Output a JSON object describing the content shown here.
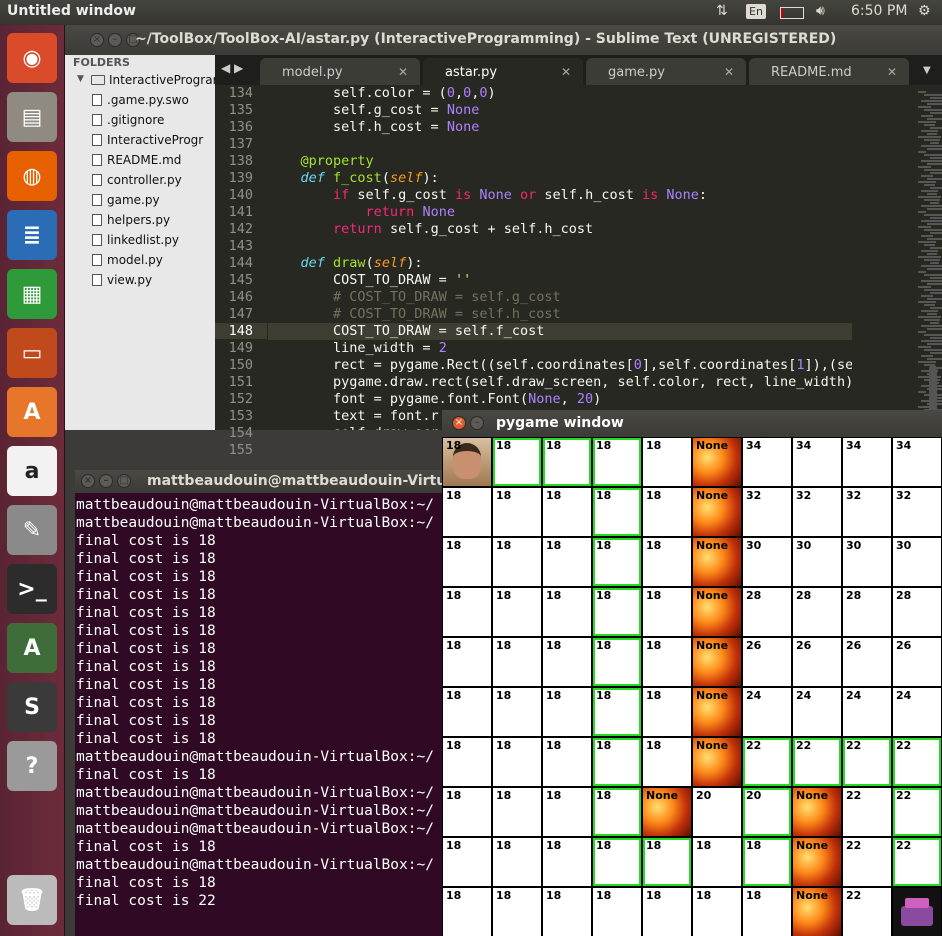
{
  "topbar": {
    "title": "Untitled window",
    "keyboard": "En",
    "time": "6:50 PM"
  },
  "launcher": {
    "items": [
      {
        "name": "dash-button",
        "icon": "ubuntu-logo-icon",
        "color": "#d94b29"
      },
      {
        "name": "files-button",
        "icon": "file-cabinet-icon",
        "color": "#8f8b80"
      },
      {
        "name": "firefox-button",
        "icon": "firefox-icon",
        "color": "#e66000"
      },
      {
        "name": "writer-button",
        "icon": "writer-document-icon",
        "color": "#2a6db5"
      },
      {
        "name": "calc-button",
        "icon": "calc-spreadsheet-icon",
        "color": "#2e9a3a"
      },
      {
        "name": "impress-button",
        "icon": "impress-presentation-icon",
        "color": "#c04a1c"
      },
      {
        "name": "software-center-button",
        "icon": "shopping-bag-icon",
        "color": "#e7762a"
      },
      {
        "name": "amazon-button",
        "icon": "amazon-icon",
        "color": "#f2f2f2"
      },
      {
        "name": "settings-button",
        "icon": "wrench-gear-icon",
        "color": "#8a8a8a"
      },
      {
        "name": "terminal-button",
        "icon": "terminal-icon",
        "color": "#2c2c2c"
      },
      {
        "name": "updater-button",
        "icon": "update-icon",
        "color": "#3f6d3a"
      },
      {
        "name": "sublime-button",
        "icon": "sublime-icon",
        "color": "#3a3a3a"
      },
      {
        "name": "help-button",
        "icon": "question-mark-icon",
        "color": "#9a9a9a"
      },
      {
        "name": "trash-button",
        "icon": "trash-icon",
        "color": "#bbbbbb"
      }
    ]
  },
  "sublime": {
    "title": "~/ToolBox/ToolBox-AI/astar.py (InteractiveProgramming) - Sublime Text (UNREGISTERED)",
    "sidebar": {
      "header": "FOLDERS",
      "folder": "InteractiveProgram",
      "files": [
        ".game.py.swo",
        ".gitignore",
        "InteractiveProgr",
        "README.md",
        "controller.py",
        "game.py",
        "helpers.py",
        "linkedlist.py",
        "model.py",
        "view.py"
      ]
    },
    "tabs": [
      {
        "label": "model.py"
      },
      {
        "label": "astar.py"
      },
      {
        "label": "game.py"
      },
      {
        "label": "README.md"
      }
    ],
    "line_numbers": [
      "134",
      "135",
      "136",
      "137",
      "138",
      "139",
      "140",
      "141",
      "142",
      "143",
      "144",
      "145",
      "146",
      "147",
      "148",
      "149",
      "150",
      "151",
      "152",
      "153",
      "154",
      "155"
    ]
  },
  "terminal": {
    "title": "mattbeaudouin@mattbeaudouin-VirtualB",
    "lines": [
      "mattbeaudouin@mattbeaudouin-VirtualBox:~/",
      "mattbeaudouin@mattbeaudouin-VirtualBox:~/",
      "final cost is 18",
      "final cost is 18",
      "final cost is 18",
      "final cost is 18",
      "final cost is 18",
      "final cost is 18",
      "final cost is 18",
      "final cost is 18",
      "final cost is 18",
      "final cost is 18",
      "final cost is 18",
      "final cost is 18",
      "mattbeaudouin@mattbeaudouin-VirtualBox:~/",
      "final cost is 18",
      "mattbeaudouin@mattbeaudouin-VirtualBox:~/",
      "mattbeaudouin@mattbeaudouin-VirtualBox:~/",
      "mattbeaudouin@mattbeaudouin-VirtualBox:~/",
      "final cost is 18",
      "mattbeaudouin@mattbeaudouin-VirtualBox:~/",
      "final cost is 18",
      "final cost is 22"
    ]
  },
  "pygame": {
    "title": "pygame window",
    "rows": [
      [
        {
          "v": "18",
          "s": "start"
        },
        {
          "v": "18",
          "s": "green"
        },
        {
          "v": "18",
          "s": "green"
        },
        {
          "v": "18",
          "s": "green"
        },
        {
          "v": "18",
          "s": ""
        },
        {
          "v": "None",
          "s": "fire"
        },
        {
          "v": "34",
          "s": ""
        },
        {
          "v": "34",
          "s": ""
        },
        {
          "v": "34",
          "s": ""
        },
        {
          "v": "34",
          "s": ""
        }
      ],
      [
        {
          "v": "18",
          "s": ""
        },
        {
          "v": "18",
          "s": ""
        },
        {
          "v": "18",
          "s": ""
        },
        {
          "v": "18",
          "s": "green"
        },
        {
          "v": "18",
          "s": ""
        },
        {
          "v": "None",
          "s": "fire"
        },
        {
          "v": "32",
          "s": ""
        },
        {
          "v": "32",
          "s": ""
        },
        {
          "v": "32",
          "s": ""
        },
        {
          "v": "32",
          "s": ""
        }
      ],
      [
        {
          "v": "18",
          "s": ""
        },
        {
          "v": "18",
          "s": ""
        },
        {
          "v": "18",
          "s": ""
        },
        {
          "v": "18",
          "s": "green"
        },
        {
          "v": "18",
          "s": ""
        },
        {
          "v": "None",
          "s": "fire"
        },
        {
          "v": "30",
          "s": ""
        },
        {
          "v": "30",
          "s": ""
        },
        {
          "v": "30",
          "s": ""
        },
        {
          "v": "30",
          "s": ""
        }
      ],
      [
        {
          "v": "18",
          "s": ""
        },
        {
          "v": "18",
          "s": ""
        },
        {
          "v": "18",
          "s": ""
        },
        {
          "v": "18",
          "s": "green"
        },
        {
          "v": "18",
          "s": ""
        },
        {
          "v": "None",
          "s": "fire"
        },
        {
          "v": "28",
          "s": ""
        },
        {
          "v": "28",
          "s": ""
        },
        {
          "v": "28",
          "s": ""
        },
        {
          "v": "28",
          "s": ""
        }
      ],
      [
        {
          "v": "18",
          "s": ""
        },
        {
          "v": "18",
          "s": ""
        },
        {
          "v": "18",
          "s": ""
        },
        {
          "v": "18",
          "s": "green"
        },
        {
          "v": "18",
          "s": ""
        },
        {
          "v": "None",
          "s": "fire"
        },
        {
          "v": "26",
          "s": ""
        },
        {
          "v": "26",
          "s": ""
        },
        {
          "v": "26",
          "s": ""
        },
        {
          "v": "26",
          "s": ""
        }
      ],
      [
        {
          "v": "18",
          "s": ""
        },
        {
          "v": "18",
          "s": ""
        },
        {
          "v": "18",
          "s": ""
        },
        {
          "v": "18",
          "s": "green"
        },
        {
          "v": "18",
          "s": ""
        },
        {
          "v": "None",
          "s": "fire"
        },
        {
          "v": "24",
          "s": ""
        },
        {
          "v": "24",
          "s": ""
        },
        {
          "v": "24",
          "s": ""
        },
        {
          "v": "24",
          "s": ""
        }
      ],
      [
        {
          "v": "18",
          "s": ""
        },
        {
          "v": "18",
          "s": ""
        },
        {
          "v": "18",
          "s": ""
        },
        {
          "v": "18",
          "s": "green"
        },
        {
          "v": "18",
          "s": ""
        },
        {
          "v": "None",
          "s": "fire"
        },
        {
          "v": "22",
          "s": "green"
        },
        {
          "v": "22",
          "s": "green"
        },
        {
          "v": "22",
          "s": "green"
        },
        {
          "v": "22",
          "s": "green"
        }
      ],
      [
        {
          "v": "18",
          "s": ""
        },
        {
          "v": "18",
          "s": ""
        },
        {
          "v": "18",
          "s": ""
        },
        {
          "v": "18",
          "s": "green"
        },
        {
          "v": "None",
          "s": "fire"
        },
        {
          "v": "20",
          "s": ""
        },
        {
          "v": "20",
          "s": "green"
        },
        {
          "v": "None",
          "s": "fire"
        },
        {
          "v": "22",
          "s": ""
        },
        {
          "v": "22",
          "s": "green"
        }
      ],
      [
        {
          "v": "18",
          "s": ""
        },
        {
          "v": "18",
          "s": ""
        },
        {
          "v": "18",
          "s": ""
        },
        {
          "v": "18",
          "s": "green"
        },
        {
          "v": "18",
          "s": "green"
        },
        {
          "v": "18",
          "s": ""
        },
        {
          "v": "18",
          "s": "green"
        },
        {
          "v": "None",
          "s": "fire"
        },
        {
          "v": "22",
          "s": ""
        },
        {
          "v": "22",
          "s": "green"
        }
      ],
      [
        {
          "v": "18",
          "s": ""
        },
        {
          "v": "18",
          "s": ""
        },
        {
          "v": "18",
          "s": ""
        },
        {
          "v": "18",
          "s": ""
        },
        {
          "v": "18",
          "s": ""
        },
        {
          "v": "18",
          "s": ""
        },
        {
          "v": "18",
          "s": ""
        },
        {
          "v": "None",
          "s": "fire"
        },
        {
          "v": "22",
          "s": ""
        },
        {
          "v": "",
          "s": "goal"
        }
      ]
    ]
  }
}
